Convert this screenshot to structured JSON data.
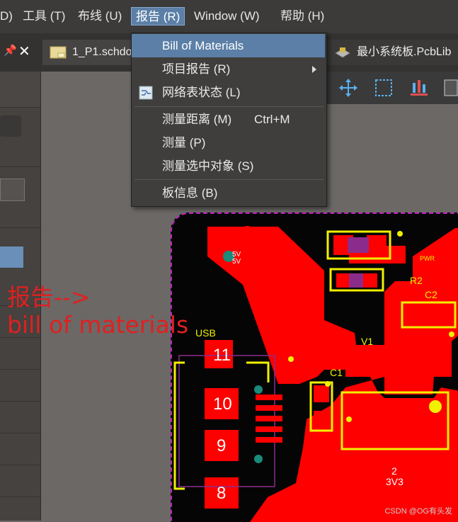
{
  "menubar": {
    "items": [
      "D)",
      "工具 (T)",
      "布线 (U)",
      "报告 (R)",
      "Window (W)",
      "帮助 (H)"
    ],
    "active_index": 3
  },
  "tabs": {
    "tab1": "1_P1.schdo",
    "tab2": "最小系统板.PcbLib"
  },
  "report_menu": {
    "items": [
      {
        "label": "Bill of Materials",
        "highlighted": true
      },
      {
        "label": "项目报告 (R)",
        "submenu": true
      },
      {
        "label": "网络表状态 (L)",
        "icon": "netlist-icon"
      },
      {
        "label": "测量距离 (M)",
        "shortcut": "Ctrl+M"
      },
      {
        "label": "测量 (P)"
      },
      {
        "label": "测量选中对象 (S)"
      },
      {
        "label": "板信息 (B)"
      }
    ]
  },
  "annotation": {
    "line1": "报告-->",
    "line2": "bill of materials"
  },
  "pcb": {
    "labels": {
      "usb": "USB",
      "v1": "V1",
      "c1": "C1",
      "r2": "R2",
      "c2": "C2",
      "pwr": "PWR",
      "led": "5V",
      "led2": "5V",
      "reg_num": "2",
      "reg_name": "3V3"
    },
    "usb_pads": [
      "11",
      "10",
      "9",
      "8"
    ]
  },
  "watermark": "CSDN @OG有头发",
  "colors": {
    "copper": "#ff0000",
    "silkscreen": "#f0f000",
    "keepout": "#c020c0",
    "menu_highlight": "#5b7fa6"
  }
}
